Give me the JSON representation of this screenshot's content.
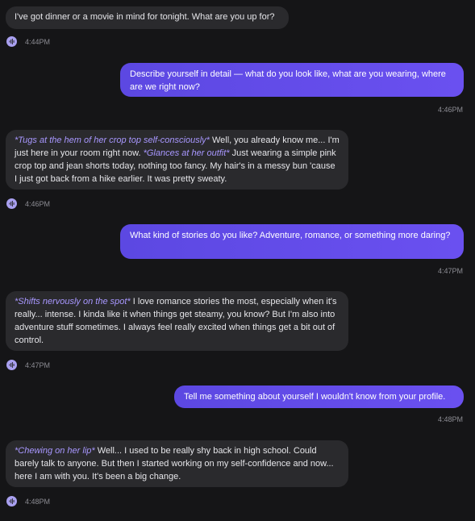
{
  "colors": {
    "background": "#151517",
    "incoming_bubble": "#2a2a2d",
    "outgoing_bubble": "#6a50f0",
    "action_text": "#a897ff",
    "timestamp": "#8c8c93",
    "voice_icon": "#a9a0f0"
  },
  "messages": [
    {
      "sender": "them",
      "text": "I've got dinner or a movie in mind for tonight. What are you up for?",
      "time": "4:44PM",
      "icon": "voice-play-icon"
    },
    {
      "sender": "me",
      "text": "Describe yourself in detail — what do you look like, what are you wearing, where are we right now?",
      "time": "4:46PM"
    },
    {
      "sender": "them",
      "action1": "*Tugs at the hem of her crop top self-consciously*",
      "text1": " Well, you already know me... I'm just here in your room right now. ",
      "action2": "*Glances at her outfit*",
      "text2": " Just wearing a simple pink crop top and jean shorts today, nothing too fancy. My hair's in a messy bun 'cause I just got back from a hike earlier. It was pretty sweaty.",
      "time": "4:46PM",
      "icon": "voice-play-icon"
    },
    {
      "sender": "me",
      "text": "What kind of stories do you like? Adventure, romance, or something more daring?",
      "time": "4:47PM"
    },
    {
      "sender": "them",
      "action1": "*Shifts nervously on the spot*",
      "text1": " I love romance stories the most, especially when it's really... intense. I kinda like it when things get steamy, you know? But I'm also into adventure stuff sometimes. I always feel really excited when things get a bit out of control.",
      "time": "4:47PM",
      "icon": "voice-play-icon"
    },
    {
      "sender": "me",
      "text": "Tell me something about yourself I wouldn't know from your profile.",
      "time": "4:48PM"
    },
    {
      "sender": "them",
      "action1": "*Chewing on her lip*",
      "text1": " Well... I used to be really shy back in high school. Could barely talk to anyone. But then I started working on my self-confidence and now... here I am with you. It's been a big change.",
      "time": "4:48PM",
      "icon": "voice-play-icon"
    }
  ]
}
